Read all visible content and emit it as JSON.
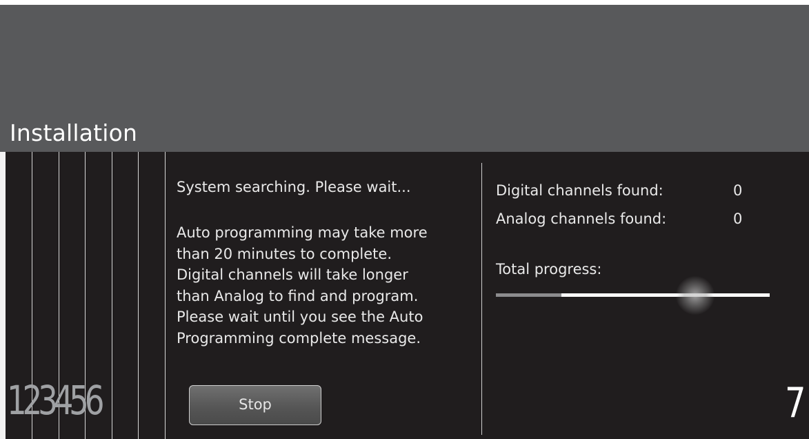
{
  "header": {
    "title": "Installation"
  },
  "steps": {
    "completed": "123456",
    "current": "7"
  },
  "message": {
    "status": "System searching. Please wait...",
    "lines": [
      "Auto programming may take more",
      "than 20 minutes to complete.",
      "Digital channels will take longer",
      "than Analog to find and program.",
      "Please wait until you see the Auto",
      "Programming complete message."
    ]
  },
  "buttons": {
    "stop_label": "Stop"
  },
  "stats": {
    "digital_label": "Digital channels found:",
    "digital_value": "0",
    "analog_label": "Analog channels found:",
    "analog_value": "0"
  },
  "progress": {
    "label": "Total progress:",
    "fraction": 0.24
  },
  "colors": {
    "header": "#58595b",
    "background": "#201d1e",
    "text": "#e9e9e9"
  }
}
